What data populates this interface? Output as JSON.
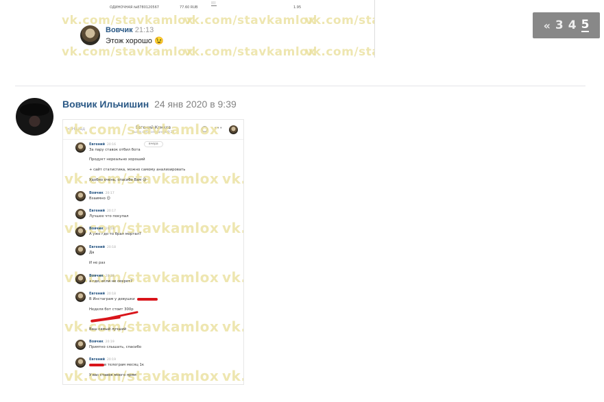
{
  "top_post": {
    "receipt_left": "ОДИНОЧНАЯ №8780120567",
    "receipt_amount": "77.60 RUB",
    "receipt_right": "1.95",
    "sender": "Вовчик",
    "time": "21:13",
    "message": "Этож хорошо 😉",
    "watermark": "vk.com/stavkamlox"
  },
  "pagination": {
    "prev": "«",
    "pages": [
      "3",
      "4",
      "5"
    ],
    "current": "5"
  },
  "post": {
    "author": "Вовчик Ильчишин",
    "date": "24 янв 2020 в 9:39"
  },
  "chat": {
    "back": "< Назад",
    "title": "Евгений Комков",
    "subtitle": "был в сети сегодня в 9:22",
    "yesterday": "вчера",
    "watermark": "vk.com/stavkamlox",
    "messages": [
      {
        "name": "Евгений",
        "time": "20:16",
        "lines": [
          "За пару ставок отбил бота",
          "Продукт нереально хороший",
          "+ сайт статистика, можно самому анализировать",
          "Удобно очень, спасибо Вам 😉"
        ]
      },
      {
        "name": "Вовчик",
        "time": "20:17",
        "lines": [
          "Взаимно 😉"
        ]
      },
      {
        "name": "Евгений",
        "time": "20:17",
        "lines": [
          "Лучшее что покупал"
        ]
      },
      {
        "name": "Вовчик",
        "time": "20:18",
        "lines": [
          "А уже где-то брал мортал?"
        ]
      },
      {
        "name": "Евгений",
        "time": "20:18",
        "lines": [
          "Да",
          "И не раз"
        ]
      },
      {
        "name": "Вовчик",
        "time": "20:18",
        "lines": [
          "а где, если не секрет?"
        ]
      },
      {
        "name": "Евгений",
        "time": "20:18",
        "lines": [
          "В Инстаграм у девушки",
          "Неделя бот стоит 300р",
          "",
          "Ваш самый лучший"
        ]
      },
      {
        "name": "Вовчик",
        "time": "20:19",
        "lines": [
          "Приятно слышать, спасибо"
        ]
      },
      {
        "name": "Евгений",
        "time": "20:19",
        "lines": [
          "в телеграм месяц 1к",
          "У вас ставок много прям"
        ]
      }
    ]
  }
}
